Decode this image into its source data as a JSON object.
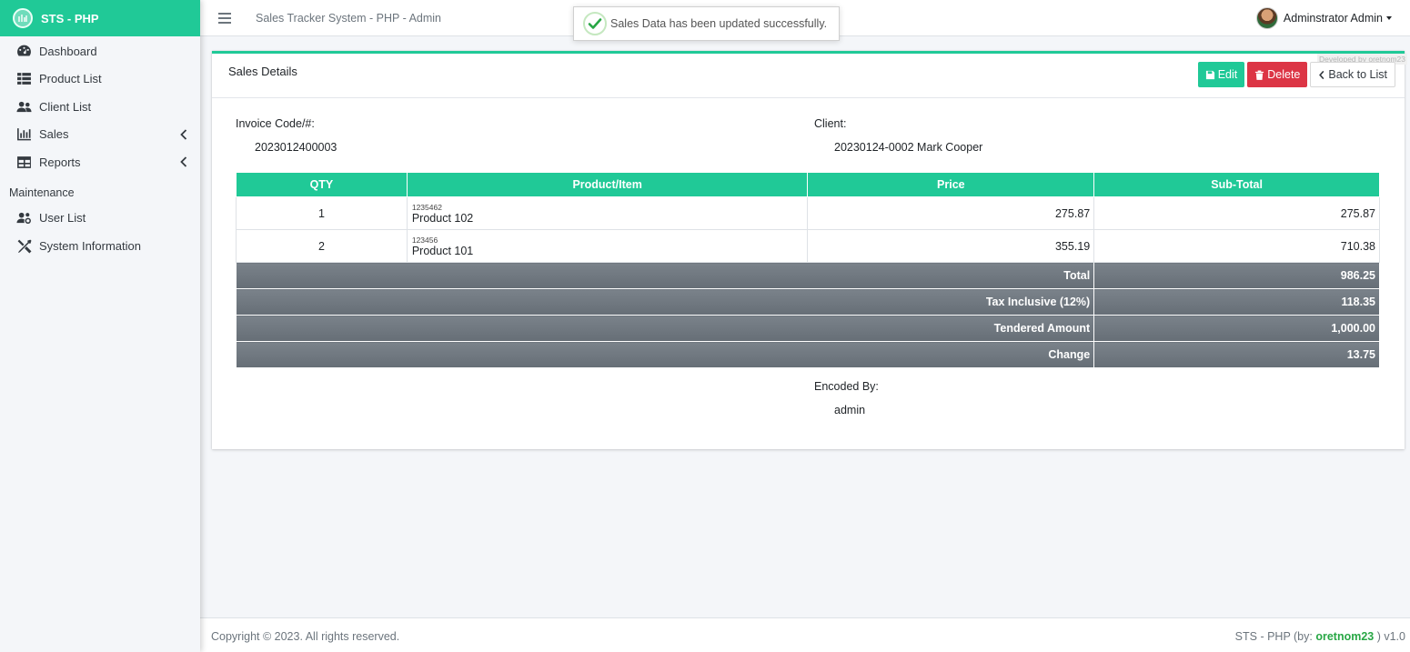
{
  "brand": {
    "name": "STS - PHP"
  },
  "sidebar": {
    "items": [
      {
        "label": "Dashboard",
        "icon": "dashboard-icon"
      },
      {
        "label": "Product List",
        "icon": "list-icon"
      },
      {
        "label": "Client List",
        "icon": "users-icon"
      },
      {
        "label": "Sales",
        "icon": "chart-icon",
        "has_arrow": true
      },
      {
        "label": "Reports",
        "icon": "table-icon",
        "has_arrow": true
      }
    ],
    "maintenance_header": "Maintenance",
    "maintenance_items": [
      {
        "label": "User List",
        "icon": "users-cog-icon"
      },
      {
        "label": "System Information",
        "icon": "tools-icon"
      }
    ]
  },
  "topbar": {
    "title": "Sales Tracker System - PHP - Admin",
    "user_name": "Adminstrator Admin"
  },
  "toast": {
    "message": "Sales Data has been updated successfully."
  },
  "card": {
    "title": "Sales Details",
    "watermark": "Developed by oretnom23",
    "buttons": {
      "edit": "Edit",
      "delete": "Delete",
      "back": "Back to List"
    },
    "invoice_label": "Invoice Code/#:",
    "invoice_value": "2023012400003",
    "client_label": "Client:",
    "client_value": "20230124-0002 Mark Cooper",
    "table": {
      "headers": [
        "QTY",
        "Product/Item",
        "Price",
        "Sub-Total"
      ],
      "rows": [
        {
          "qty": "1",
          "code": "1235462",
          "name": "Product 102",
          "price": "275.87",
          "subtotal": "275.87"
        },
        {
          "qty": "2",
          "code": "123456",
          "name": "Product 101",
          "price": "355.19",
          "subtotal": "710.38"
        }
      ],
      "summary": [
        {
          "label": "Total",
          "value": "986.25"
        },
        {
          "label": "Tax Inclusive (12%)",
          "value": "118.35"
        },
        {
          "label": "Tendered Amount",
          "value": "1,000.00"
        },
        {
          "label": "Change",
          "value": "13.75"
        }
      ]
    },
    "encoded_label": "Encoded By:",
    "encoded_value": "admin"
  },
  "footer": {
    "copyright": "Copyright © 2023. All rights reserved.",
    "right_prefix": "STS - PHP (by: ",
    "right_author": "oretnom23",
    "right_suffix": " ) v1.0"
  },
  "colors": {
    "accent": "#20c997",
    "danger": "#dc3545",
    "summary_bg": "#6c757d"
  }
}
